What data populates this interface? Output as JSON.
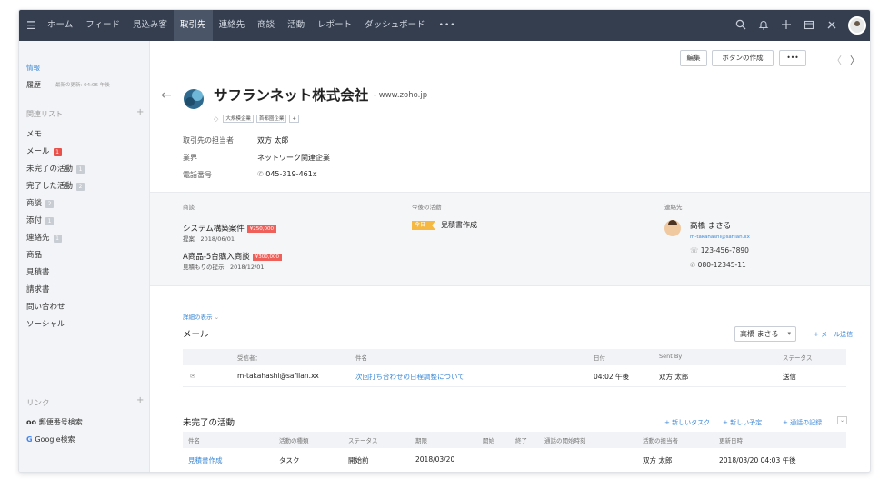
{
  "topbar": {
    "nav": [
      "ホーム",
      "フィード",
      "見込み客",
      "取引先",
      "連絡先",
      "商談",
      "活動",
      "レポート",
      "ダッシュボード"
    ],
    "active_nav": "取引先",
    "more": "•••",
    "icons": [
      "search-icon",
      "bell-icon",
      "plus-icon",
      "calendar-icon",
      "settings-icon",
      "avatar"
    ]
  },
  "sidebar": {
    "info": "情報",
    "history": "履歴",
    "history_meta": "最新の更新: 04:06 午後",
    "related_list": "関連リスト",
    "items": [
      {
        "label": "メモ",
        "badge": null,
        "badge_color": null
      },
      {
        "label": "メール",
        "badge": "1",
        "badge_color": "#e8504a"
      },
      {
        "label": "未完了の活動",
        "badge": "1",
        "badge_color": "#c8ccd3"
      },
      {
        "label": "完了した活動",
        "badge": "2",
        "badge_color": "#c8ccd3"
      },
      {
        "label": "商談",
        "badge": "2",
        "badge_color": "#c8ccd3"
      },
      {
        "label": "添付",
        "badge": "1",
        "badge_color": "#c8ccd3"
      },
      {
        "label": "連絡先",
        "badge": "1",
        "badge_color": "#c8ccd3"
      },
      {
        "label": "商品",
        "badge": null,
        "badge_color": null
      },
      {
        "label": "見積書",
        "badge": null,
        "badge_color": null
      },
      {
        "label": "請求書",
        "badge": null,
        "badge_color": null
      },
      {
        "label": "問い合わせ",
        "badge": null,
        "badge_color": null
      },
      {
        "label": "ソーシャル",
        "badge": null,
        "badge_color": null
      }
    ],
    "links": "リンク",
    "link_postal": "郵便番号検索",
    "link_google": "Google検索"
  },
  "actions": {
    "edit": "編集",
    "create_button": "ボタンの作成",
    "more": "•••",
    "prev": "〈",
    "next": "〉"
  },
  "account": {
    "name": "サフランネット株式会社",
    "website": "- www.zoho.jp",
    "tags": [
      "大規模企業",
      "首都圏企業"
    ],
    "tag_add": "+",
    "fields": [
      {
        "label": "取引先の担当者",
        "value": "双方 太郎"
      },
      {
        "label": "業界",
        "value": "ネットワーク関連企業"
      },
      {
        "label": "電話番号",
        "value": "045-319-461x"
      }
    ]
  },
  "summary": {
    "deals_head": "商談",
    "deals": [
      {
        "name": "システム構築案件",
        "amount": "¥250,000",
        "meta": "提案　2018/06/01"
      },
      {
        "name": "A商品-5台購入商談",
        "amount": "¥300,000",
        "meta": "見積もりの提示　2018/12/01"
      }
    ],
    "activities_head": "今後の活動",
    "activity_badge": "今日",
    "activity_text": "見積書作成",
    "contacts_head": "連絡先",
    "contact_name": "高橋 まさる",
    "contact_email": "m-takahashi@safilan.xx",
    "contact_phone": "123-456-7890",
    "contact_mobile": "080-12345-11"
  },
  "mail": {
    "detail_link": "詳細の表示",
    "title": "メール",
    "owner_select": "高橋 まさる",
    "send_mail": "+ メール送信",
    "columns": [
      "受信者：",
      "件名",
      "日付",
      "Sent By",
      "ステータス"
    ],
    "rows": [
      {
        "recipient": "m-takahashi@safilan.xx",
        "subject": "次回打ち合わせの日程調整について",
        "date": "04:02 午後",
        "sent_by": "双方 太郎",
        "status": "送信"
      }
    ]
  },
  "open_activities": {
    "title": "未完了の活動",
    "new_task": "+ 新しいタスク",
    "new_event": "+ 新しい予定",
    "log_call": "+ 通話の記録",
    "columns": [
      "件名",
      "活動の種類",
      "ステータス",
      "期限",
      "開始",
      "終了",
      "通話の開始時刻",
      "活動の担当者",
      "更新日時"
    ],
    "rows": [
      {
        "subject": "見積書作成",
        "type": "タスク",
        "status": "開始前",
        "due": "2018/03/20",
        "start": "",
        "end": "",
        "call_start": "",
        "owner": "双方 太郎",
        "modified": "2018/03/20 04:03 午後"
      }
    ]
  }
}
